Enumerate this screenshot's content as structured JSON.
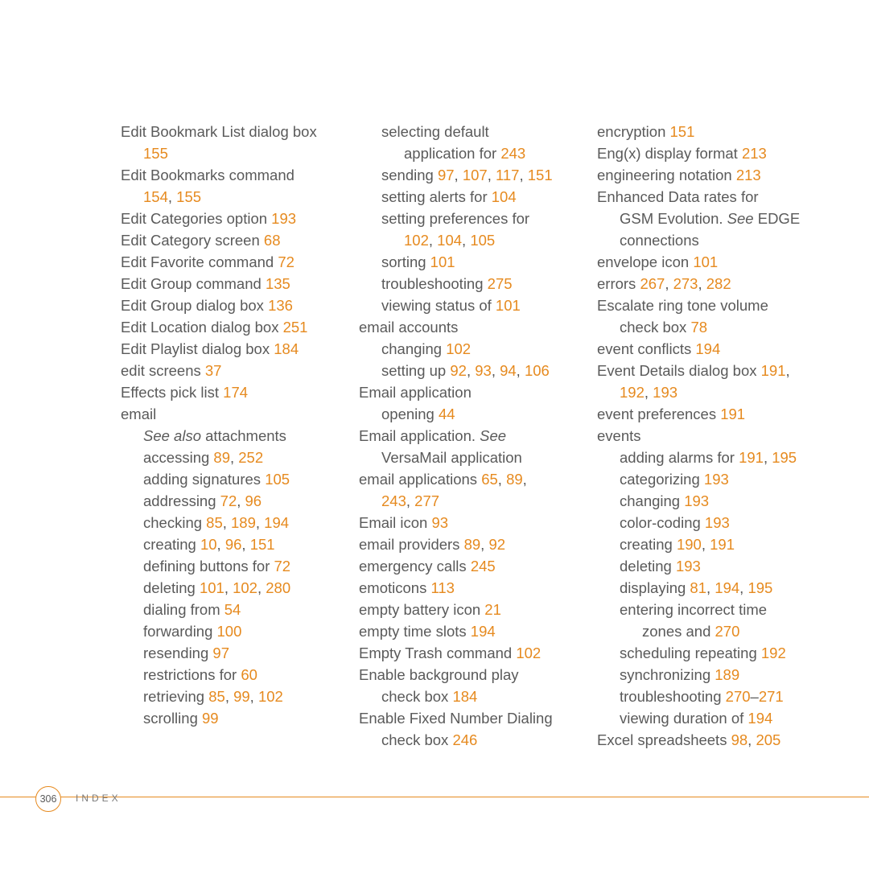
{
  "page_number": "306",
  "footer_label": "INDEX",
  "columns": [
    [
      {
        "indent": 0,
        "parts": [
          {
            "t": "Edit Bookmark List dialog box "
          }
        ]
      },
      {
        "indent": 1,
        "parts": [
          {
            "t": "155",
            "pg": true
          }
        ]
      },
      {
        "indent": 0,
        "parts": [
          {
            "t": "Edit Bookmarks command "
          }
        ]
      },
      {
        "indent": 1,
        "parts": [
          {
            "t": "154",
            "pg": true
          },
          {
            "t": ", "
          },
          {
            "t": "155",
            "pg": true
          }
        ]
      },
      {
        "indent": 0,
        "parts": [
          {
            "t": "Edit Categories option "
          },
          {
            "t": "193",
            "pg": true
          }
        ]
      },
      {
        "indent": 0,
        "parts": [
          {
            "t": "Edit Category screen "
          },
          {
            "t": "68",
            "pg": true
          }
        ]
      },
      {
        "indent": 0,
        "parts": [
          {
            "t": "Edit Favorite command "
          },
          {
            "t": "72",
            "pg": true
          }
        ]
      },
      {
        "indent": 0,
        "parts": [
          {
            "t": "Edit Group command "
          },
          {
            "t": "135",
            "pg": true
          }
        ]
      },
      {
        "indent": 0,
        "parts": [
          {
            "t": "Edit Group dialog box "
          },
          {
            "t": "136",
            "pg": true
          }
        ]
      },
      {
        "indent": 0,
        "parts": [
          {
            "t": "Edit Location dialog box "
          },
          {
            "t": "251",
            "pg": true
          }
        ]
      },
      {
        "indent": 0,
        "parts": [
          {
            "t": "Edit Playlist dialog box "
          },
          {
            "t": "184",
            "pg": true
          }
        ]
      },
      {
        "indent": 0,
        "parts": [
          {
            "t": "edit screens "
          },
          {
            "t": "37",
            "pg": true
          }
        ]
      },
      {
        "indent": 0,
        "parts": [
          {
            "t": "Effects pick list "
          },
          {
            "t": "174",
            "pg": true
          }
        ]
      },
      {
        "indent": 0,
        "parts": [
          {
            "t": "email"
          }
        ]
      },
      {
        "indent": 1,
        "parts": [
          {
            "t": "See also",
            "italic": true
          },
          {
            "t": " attachments"
          }
        ]
      },
      {
        "indent": 1,
        "parts": [
          {
            "t": "accessing "
          },
          {
            "t": "89",
            "pg": true
          },
          {
            "t": ", "
          },
          {
            "t": "252",
            "pg": true
          }
        ]
      },
      {
        "indent": 1,
        "parts": [
          {
            "t": "adding signatures "
          },
          {
            "t": "105",
            "pg": true
          }
        ]
      },
      {
        "indent": 1,
        "parts": [
          {
            "t": "addressing "
          },
          {
            "t": "72",
            "pg": true
          },
          {
            "t": ", "
          },
          {
            "t": "96",
            "pg": true
          }
        ]
      },
      {
        "indent": 1,
        "parts": [
          {
            "t": "checking "
          },
          {
            "t": "85",
            "pg": true
          },
          {
            "t": ", "
          },
          {
            "t": "189",
            "pg": true
          },
          {
            "t": ", "
          },
          {
            "t": "194",
            "pg": true
          }
        ]
      },
      {
        "indent": 1,
        "parts": [
          {
            "t": "creating "
          },
          {
            "t": "10",
            "pg": true
          },
          {
            "t": ", "
          },
          {
            "t": "96",
            "pg": true
          },
          {
            "t": ", "
          },
          {
            "t": "151",
            "pg": true
          }
        ]
      },
      {
        "indent": 1,
        "parts": [
          {
            "t": "defining buttons for "
          },
          {
            "t": "72",
            "pg": true
          }
        ]
      },
      {
        "indent": 1,
        "parts": [
          {
            "t": "deleting "
          },
          {
            "t": "101",
            "pg": true
          },
          {
            "t": ", "
          },
          {
            "t": "102",
            "pg": true
          },
          {
            "t": ", "
          },
          {
            "t": "280",
            "pg": true
          }
        ]
      },
      {
        "indent": 1,
        "parts": [
          {
            "t": "dialing from "
          },
          {
            "t": "54",
            "pg": true
          }
        ]
      },
      {
        "indent": 1,
        "parts": [
          {
            "t": "forwarding "
          },
          {
            "t": "100",
            "pg": true
          }
        ]
      },
      {
        "indent": 1,
        "parts": [
          {
            "t": "resending "
          },
          {
            "t": "97",
            "pg": true
          }
        ]
      },
      {
        "indent": 1,
        "parts": [
          {
            "t": "restrictions for "
          },
          {
            "t": "60",
            "pg": true
          }
        ]
      },
      {
        "indent": 1,
        "parts": [
          {
            "t": "retrieving "
          },
          {
            "t": "85",
            "pg": true
          },
          {
            "t": ", "
          },
          {
            "t": "99",
            "pg": true
          },
          {
            "t": ", "
          },
          {
            "t": "102",
            "pg": true
          }
        ]
      },
      {
        "indent": 1,
        "parts": [
          {
            "t": "scrolling "
          },
          {
            "t": "99",
            "pg": true
          }
        ]
      }
    ],
    [
      {
        "indent": 1,
        "parts": [
          {
            "t": "selecting default "
          }
        ]
      },
      {
        "indent": 2,
        "parts": [
          {
            "t": "application for "
          },
          {
            "t": "243",
            "pg": true
          }
        ]
      },
      {
        "indent": 1,
        "parts": [
          {
            "t": "sending "
          },
          {
            "t": "97",
            "pg": true
          },
          {
            "t": ", "
          },
          {
            "t": "107",
            "pg": true
          },
          {
            "t": ", "
          },
          {
            "t": "117",
            "pg": true
          },
          {
            "t": ", "
          },
          {
            "t": "151",
            "pg": true
          }
        ]
      },
      {
        "indent": 1,
        "parts": [
          {
            "t": "setting alerts for "
          },
          {
            "t": "104",
            "pg": true
          }
        ]
      },
      {
        "indent": 1,
        "parts": [
          {
            "t": "setting preferences for "
          }
        ]
      },
      {
        "indent": 2,
        "parts": [
          {
            "t": "102",
            "pg": true
          },
          {
            "t": ", "
          },
          {
            "t": "104",
            "pg": true
          },
          {
            "t": ", "
          },
          {
            "t": "105",
            "pg": true
          }
        ]
      },
      {
        "indent": 1,
        "parts": [
          {
            "t": "sorting "
          },
          {
            "t": "101",
            "pg": true
          }
        ]
      },
      {
        "indent": 1,
        "parts": [
          {
            "t": "troubleshooting "
          },
          {
            "t": "275",
            "pg": true
          }
        ]
      },
      {
        "indent": 1,
        "parts": [
          {
            "t": "viewing status of "
          },
          {
            "t": "101",
            "pg": true
          }
        ]
      },
      {
        "indent": 0,
        "parts": [
          {
            "t": "email accounts"
          }
        ]
      },
      {
        "indent": 1,
        "parts": [
          {
            "t": "changing "
          },
          {
            "t": "102",
            "pg": true
          }
        ]
      },
      {
        "indent": 1,
        "parts": [
          {
            "t": "setting up "
          },
          {
            "t": "92",
            "pg": true
          },
          {
            "t": ", "
          },
          {
            "t": "93",
            "pg": true
          },
          {
            "t": ", "
          },
          {
            "t": "94",
            "pg": true
          },
          {
            "t": ", "
          },
          {
            "t": "106",
            "pg": true
          }
        ]
      },
      {
        "indent": 0,
        "parts": [
          {
            "t": "Email application"
          }
        ]
      },
      {
        "indent": 1,
        "parts": [
          {
            "t": "opening "
          },
          {
            "t": "44",
            "pg": true
          }
        ]
      },
      {
        "indent": 0,
        "parts": [
          {
            "t": "Email application. "
          },
          {
            "t": "See",
            "italic": true
          },
          {
            "t": " "
          }
        ]
      },
      {
        "indent": 1,
        "parts": [
          {
            "t": "VersaMail application"
          }
        ]
      },
      {
        "indent": 0,
        "parts": [
          {
            "t": "email applications "
          },
          {
            "t": "65",
            "pg": true
          },
          {
            "t": ", "
          },
          {
            "t": "89",
            "pg": true
          },
          {
            "t": ", "
          }
        ]
      },
      {
        "indent": 1,
        "parts": [
          {
            "t": "243",
            "pg": true
          },
          {
            "t": ", "
          },
          {
            "t": "277",
            "pg": true
          }
        ]
      },
      {
        "indent": 0,
        "parts": [
          {
            "t": "Email icon "
          },
          {
            "t": "93",
            "pg": true
          }
        ]
      },
      {
        "indent": 0,
        "parts": [
          {
            "t": "email providers "
          },
          {
            "t": "89",
            "pg": true
          },
          {
            "t": ", "
          },
          {
            "t": "92",
            "pg": true
          }
        ]
      },
      {
        "indent": 0,
        "parts": [
          {
            "t": "emergency calls "
          },
          {
            "t": "245",
            "pg": true
          }
        ]
      },
      {
        "indent": 0,
        "parts": [
          {
            "t": "emoticons "
          },
          {
            "t": "113",
            "pg": true
          }
        ]
      },
      {
        "indent": 0,
        "parts": [
          {
            "t": "empty battery icon "
          },
          {
            "t": "21",
            "pg": true
          }
        ]
      },
      {
        "indent": 0,
        "parts": [
          {
            "t": "empty time slots "
          },
          {
            "t": "194",
            "pg": true
          }
        ]
      },
      {
        "indent": 0,
        "parts": [
          {
            "t": "Empty Trash command "
          },
          {
            "t": "102",
            "pg": true
          }
        ]
      },
      {
        "indent": 0,
        "parts": [
          {
            "t": "Enable background play "
          }
        ]
      },
      {
        "indent": 1,
        "parts": [
          {
            "t": "check box "
          },
          {
            "t": "184",
            "pg": true
          }
        ]
      },
      {
        "indent": 0,
        "parts": [
          {
            "t": "Enable Fixed Number Dialing "
          }
        ]
      },
      {
        "indent": 1,
        "parts": [
          {
            "t": "check box "
          },
          {
            "t": "246",
            "pg": true
          }
        ]
      }
    ],
    [
      {
        "indent": 0,
        "parts": [
          {
            "t": "encryption "
          },
          {
            "t": "151",
            "pg": true
          }
        ]
      },
      {
        "indent": 0,
        "parts": [
          {
            "t": "Eng(x) display format "
          },
          {
            "t": "213",
            "pg": true
          }
        ]
      },
      {
        "indent": 0,
        "parts": [
          {
            "t": "engineering notation "
          },
          {
            "t": "213",
            "pg": true
          }
        ]
      },
      {
        "indent": 0,
        "parts": [
          {
            "t": "Enhanced Data rates for "
          }
        ]
      },
      {
        "indent": 1,
        "parts": [
          {
            "t": "GSM Evolution. "
          },
          {
            "t": "See ",
            "italic": true
          },
          {
            "t": "EDGE "
          }
        ]
      },
      {
        "indent": 1,
        "parts": [
          {
            "t": "connections"
          }
        ]
      },
      {
        "indent": 0,
        "parts": [
          {
            "t": "envelope icon "
          },
          {
            "t": "101",
            "pg": true
          }
        ]
      },
      {
        "indent": 0,
        "parts": [
          {
            "t": "errors "
          },
          {
            "t": "267",
            "pg": true
          },
          {
            "t": ", "
          },
          {
            "t": "273",
            "pg": true
          },
          {
            "t": ", "
          },
          {
            "t": "282",
            "pg": true
          }
        ]
      },
      {
        "indent": 0,
        "parts": [
          {
            "t": "Escalate ring tone volume "
          }
        ]
      },
      {
        "indent": 1,
        "parts": [
          {
            "t": "check box "
          },
          {
            "t": "78",
            "pg": true
          }
        ]
      },
      {
        "indent": 0,
        "parts": [
          {
            "t": "event conflicts "
          },
          {
            "t": "194",
            "pg": true
          }
        ]
      },
      {
        "indent": 0,
        "parts": [
          {
            "t": "Event Details dialog box "
          },
          {
            "t": "191",
            "pg": true
          },
          {
            "t": ", "
          }
        ]
      },
      {
        "indent": 1,
        "parts": [
          {
            "t": "192",
            "pg": true
          },
          {
            "t": ", "
          },
          {
            "t": "193",
            "pg": true
          }
        ]
      },
      {
        "indent": 0,
        "parts": [
          {
            "t": "event preferences "
          },
          {
            "t": "191",
            "pg": true
          }
        ]
      },
      {
        "indent": 0,
        "parts": [
          {
            "t": "events"
          }
        ]
      },
      {
        "indent": 1,
        "parts": [
          {
            "t": "adding alarms for "
          },
          {
            "t": "191",
            "pg": true
          },
          {
            "t": ", "
          },
          {
            "t": "195",
            "pg": true
          }
        ]
      },
      {
        "indent": 1,
        "parts": [
          {
            "t": "categorizing "
          },
          {
            "t": "193",
            "pg": true
          }
        ]
      },
      {
        "indent": 1,
        "parts": [
          {
            "t": "changing "
          },
          {
            "t": "193",
            "pg": true
          }
        ]
      },
      {
        "indent": 1,
        "parts": [
          {
            "t": "color-coding "
          },
          {
            "t": "193",
            "pg": true
          }
        ]
      },
      {
        "indent": 1,
        "parts": [
          {
            "t": "creating "
          },
          {
            "t": "190",
            "pg": true
          },
          {
            "t": ", "
          },
          {
            "t": "191",
            "pg": true
          }
        ]
      },
      {
        "indent": 1,
        "parts": [
          {
            "t": "deleting "
          },
          {
            "t": "193",
            "pg": true
          }
        ]
      },
      {
        "indent": 1,
        "parts": [
          {
            "t": "displaying "
          },
          {
            "t": "81",
            "pg": true
          },
          {
            "t": ", "
          },
          {
            "t": "194",
            "pg": true
          },
          {
            "t": ", "
          },
          {
            "t": "195",
            "pg": true
          }
        ]
      },
      {
        "indent": 1,
        "parts": [
          {
            "t": "entering incorrect time "
          }
        ]
      },
      {
        "indent": 2,
        "parts": [
          {
            "t": "zones and "
          },
          {
            "t": "270",
            "pg": true
          }
        ]
      },
      {
        "indent": 1,
        "parts": [
          {
            "t": "scheduling repeating "
          },
          {
            "t": "192",
            "pg": true
          }
        ]
      },
      {
        "indent": 1,
        "parts": [
          {
            "t": "synchronizing "
          },
          {
            "t": "189",
            "pg": true
          }
        ]
      },
      {
        "indent": 1,
        "parts": [
          {
            "t": "troubleshooting "
          },
          {
            "t": "270",
            "pg": true
          },
          {
            "t": "–"
          },
          {
            "t": "271",
            "pg": true
          }
        ]
      },
      {
        "indent": 1,
        "parts": [
          {
            "t": "viewing duration of "
          },
          {
            "t": "194",
            "pg": true
          }
        ]
      },
      {
        "indent": 0,
        "parts": [
          {
            "t": "Excel spreadsheets "
          },
          {
            "t": "98",
            "pg": true
          },
          {
            "t": ", "
          },
          {
            "t": "205",
            "pg": true
          }
        ]
      }
    ]
  ]
}
